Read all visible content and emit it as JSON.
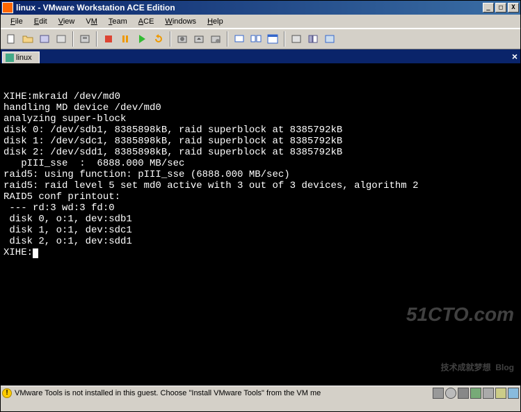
{
  "window": {
    "title": "linux - VMware Workstation ACE Edition"
  },
  "menu": {
    "file": "File",
    "edit": "Edit",
    "view": "View",
    "vm": "VM",
    "team": "Team",
    "ace": "ACE",
    "windows": "Windows",
    "help": "Help"
  },
  "tab": {
    "label": "linux"
  },
  "terminal": {
    "lines": [
      "",
      "",
      "XIHE:mkraid /dev/md0",
      "handling MD device /dev/md0",
      "analyzing super-block",
      "disk 0: /dev/sdb1, 8385898kB, raid superblock at 8385792kB",
      "disk 1: /dev/sdc1, 8385898kB, raid superblock at 8385792kB",
      "disk 2: /dev/sdd1, 8385898kB, raid superblock at 8385792kB",
      "   pIII_sse  :  6888.000 MB/sec",
      "raid5: using function: pIII_sse (6888.000 MB/sec)",
      "raid5: raid level 5 set md0 active with 3 out of 3 devices, algorithm 2",
      "RAID5 conf printout:",
      " --- rd:3 wd:3 fd:0",
      " disk 0, o:1, dev:sdb1",
      " disk 1, o:1, dev:sdc1",
      " disk 2, o:1, dev:sdd1"
    ],
    "prompt": "XIHE:"
  },
  "status": {
    "text": "VMware Tools is not installed in this guest. Choose \"Install VMware Tools\" from the VM me"
  },
  "watermark": {
    "main": "51CTO.com",
    "sub": "技术成就梦想  Blog"
  }
}
